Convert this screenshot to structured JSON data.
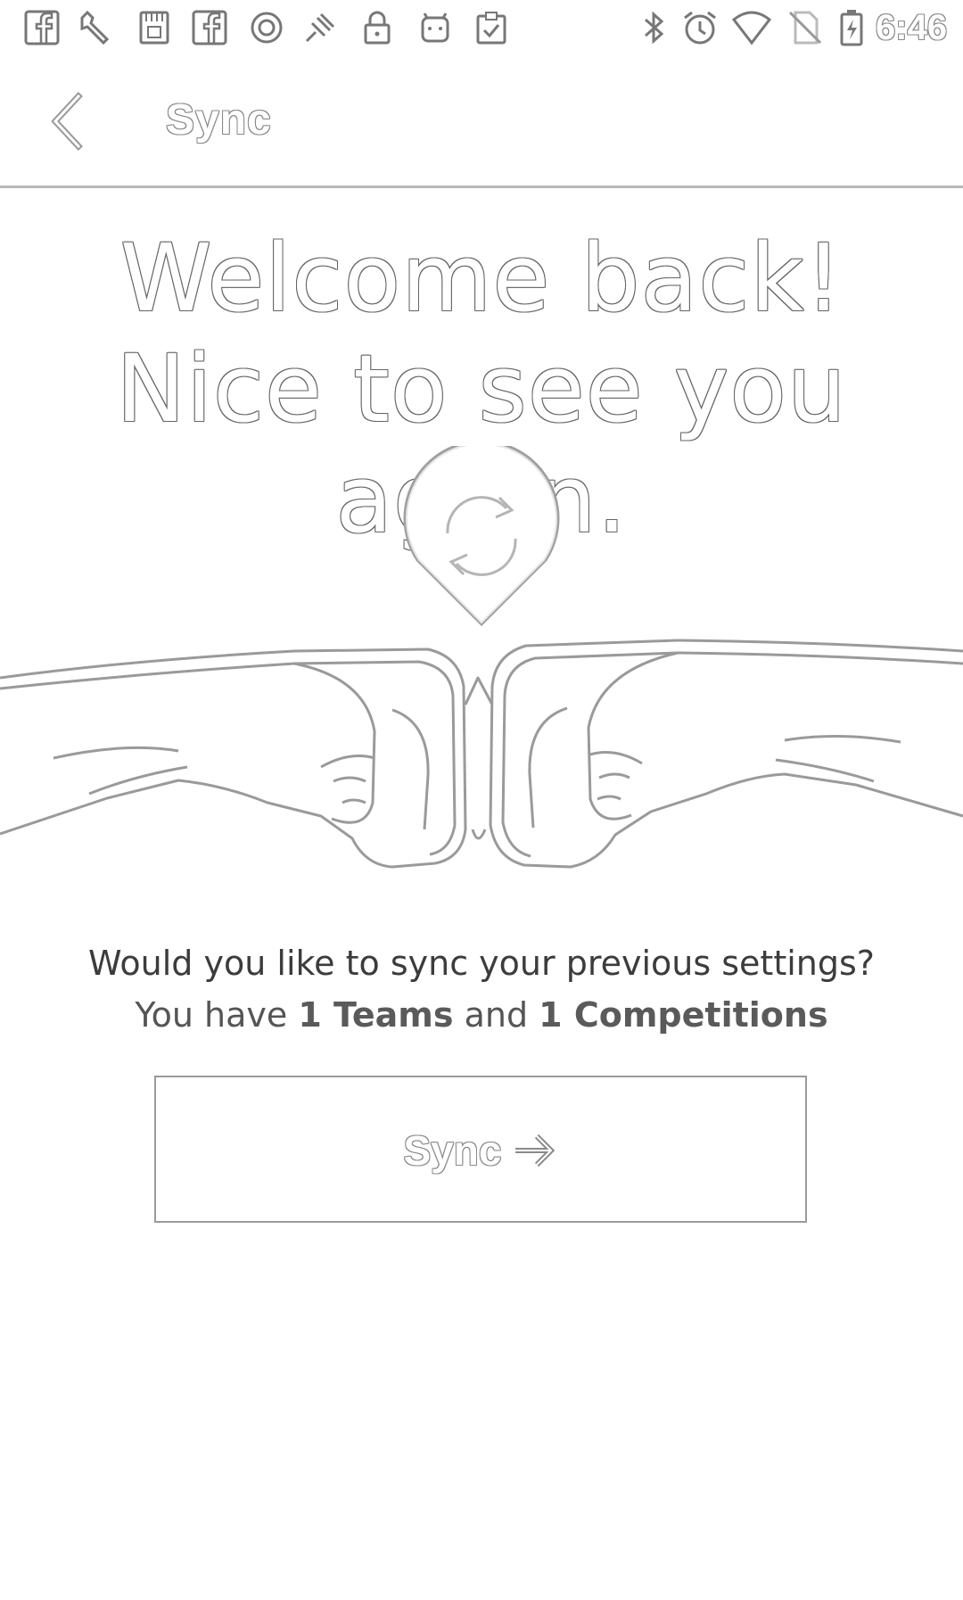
{
  "status_bar": {
    "time": "6:46",
    "left_icons": [
      "facebook-icon",
      "wrench-icon",
      "storage-card-icon",
      "facebook-icon",
      "circle-dot-icon",
      "satellite-icon",
      "lock-icon",
      "android-icon",
      "clipboard-check-icon"
    ],
    "right_icons": [
      "bluetooth-icon",
      "alarm-icon",
      "wifi-icon",
      "no-sim-icon",
      "battery-charging-icon"
    ]
  },
  "app_bar": {
    "title": "Sync",
    "back_icon": "chevron-left-icon"
  },
  "main": {
    "headline": "Welcome back! Nice to see you again.",
    "illustration": "fist-bump-illustration",
    "sync_icon": "sync-icon",
    "question": "Would you like to sync your previous settings?",
    "counts_prefix": "You have ",
    "teams_count": "1 Teams",
    "counts_middle": " and ",
    "competitions_count": "1 Competitions",
    "button_label": "Sync",
    "button_icon": "arrow-right-icon"
  },
  "colors": {
    "background": "#ffffff",
    "outline": "#8a8a8a",
    "divider": "#b9b9b9"
  }
}
